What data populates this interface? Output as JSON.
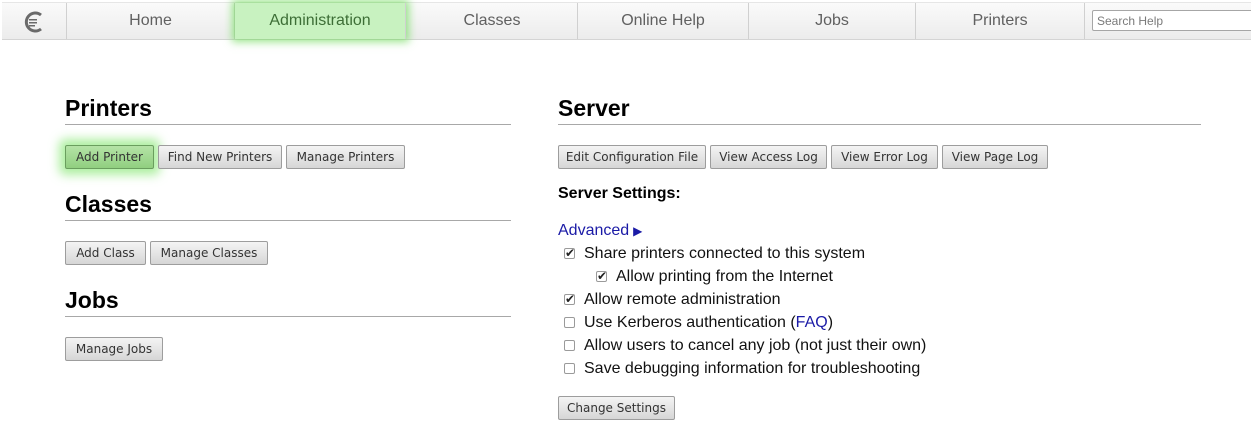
{
  "nav": {
    "logo_icon": "cups-logo-icon",
    "tabs": [
      {
        "label": "Home"
      },
      {
        "label": "Administration",
        "active": true
      },
      {
        "label": "Classes"
      },
      {
        "label": "Online Help"
      },
      {
        "label": "Jobs"
      },
      {
        "label": "Printers"
      }
    ],
    "search_placeholder": "Search Help"
  },
  "printers": {
    "heading": "Printers",
    "buttons": [
      "Add Printer",
      "Find New Printers",
      "Manage Printers"
    ]
  },
  "classes": {
    "heading": "Classes",
    "buttons": [
      "Add Class",
      "Manage Classes"
    ]
  },
  "jobs": {
    "heading": "Jobs",
    "buttons": [
      "Manage Jobs"
    ]
  },
  "server": {
    "heading": "Server",
    "buttons": [
      "Edit Configuration File",
      "View Access Log",
      "View Error Log",
      "View Page Log"
    ],
    "settings_title": "Server Settings:",
    "advanced_label": "Advanced",
    "advanced_icon": "triangle-right-icon",
    "options": [
      {
        "label": "Share printers connected to this system",
        "checked": true
      },
      {
        "label": "Allow printing from the Internet",
        "checked": true
      },
      {
        "label": "Allow remote administration",
        "checked": true
      },
      {
        "label": "Use Kerberos authentication (",
        "link": "FAQ",
        "suffix": ")",
        "checked": false
      },
      {
        "label": "Allow users to cancel any job (not just their own)",
        "checked": false
      },
      {
        "label": "Save debugging information for troubleshooting",
        "checked": false
      }
    ],
    "change_button": "Change Settings"
  },
  "colors": {
    "highlight": "#91cf80",
    "link": "#1a1aa6"
  }
}
